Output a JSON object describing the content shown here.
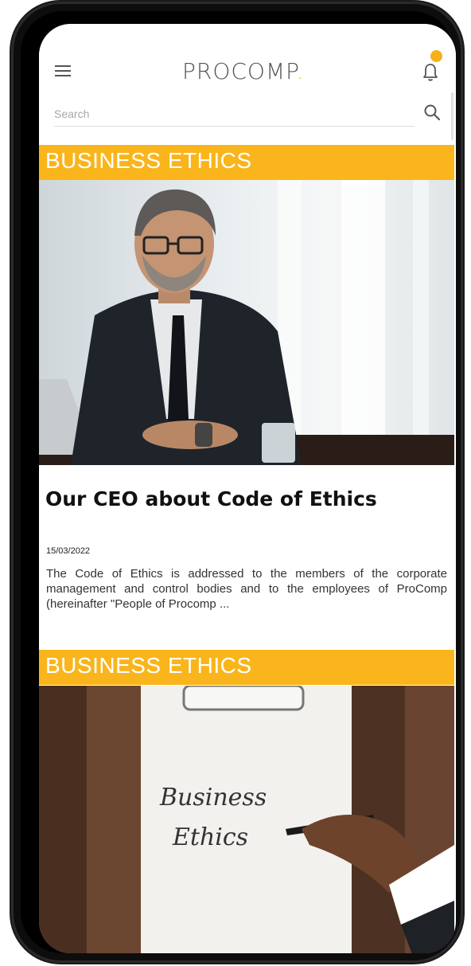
{
  "app": {
    "logo_main": "PROCOMP",
    "logo_accent": "."
  },
  "search": {
    "placeholder": "Search"
  },
  "articles": [
    {
      "category": "BUSINESS ETHICS",
      "title": "Our CEO about Code of Ethics",
      "date": "15/03/2022",
      "excerpt": "The Code of Ethics is addressed to the members of the corporate management and control bodies and to the employees of ProComp (hereinafter \"People of Procomp ..."
    },
    {
      "category": "BUSINESS ETHICS",
      "image_text_line1": "Business",
      "image_text_line2": "Ethics"
    }
  ],
  "colors": {
    "accent": "#F9B51B",
    "text": "#111111"
  },
  "icons": {
    "menu": "hamburger-menu-icon",
    "notifications": "bell-icon",
    "search": "search-icon"
  }
}
